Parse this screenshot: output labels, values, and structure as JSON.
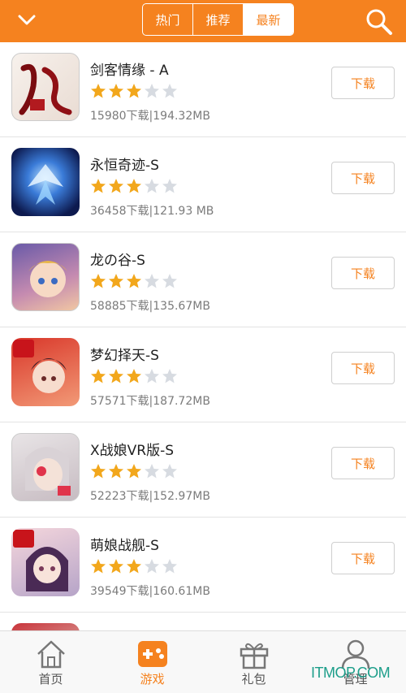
{
  "header": {
    "tabs": [
      {
        "label": "热门",
        "active": false
      },
      {
        "label": "推荐",
        "active": false
      },
      {
        "label": "最新",
        "active": true
      }
    ],
    "icons": {
      "left": "chevron-down-icon",
      "right": "search-icon"
    },
    "accent_color": "#f5821f"
  },
  "apps": [
    {
      "name": "剑客情缘 - A",
      "rating": 3,
      "max_rating": 5,
      "meta": "15980下载|194.32MB",
      "button": "下载",
      "icon": "app-icon-jianke-qingyuan"
    },
    {
      "name": "永恒奇迹-S",
      "rating": 3,
      "max_rating": 5,
      "meta": "36458下载|121.93 MB",
      "button": "下载",
      "icon": "app-icon-yongheng-qiji"
    },
    {
      "name": "龙の谷-S",
      "rating": 3,
      "max_rating": 5,
      "meta": "58885下载|135.67MB",
      "button": "下载",
      "icon": "app-icon-long-no-gu"
    },
    {
      "name": "梦幻择天-S",
      "rating": 3,
      "max_rating": 5,
      "meta": "57571下载|187.72MB",
      "button": "下载",
      "icon": "app-icon-menghuan-zetian"
    },
    {
      "name": "X战娘VR版-S",
      "rating": 3,
      "max_rating": 5,
      "meta": "52223下载|152.97MB",
      "button": "下载",
      "icon": "app-icon-x-zhanniang"
    },
    {
      "name": "萌娘战舰-S",
      "rating": 3,
      "max_rating": 5,
      "meta": "39549下载|160.61MB",
      "button": "下载",
      "icon": "app-icon-mengniang-zhanjian"
    }
  ],
  "bottom_nav": [
    {
      "label": "首页",
      "icon": "home-icon",
      "active": false
    },
    {
      "label": "游戏",
      "icon": "gamepad-icon",
      "active": true
    },
    {
      "label": "礼包",
      "icon": "gift-icon",
      "active": false
    },
    {
      "label": "管理",
      "icon": "user-icon",
      "active": false
    }
  ],
  "watermark": "ITMOP.COM"
}
